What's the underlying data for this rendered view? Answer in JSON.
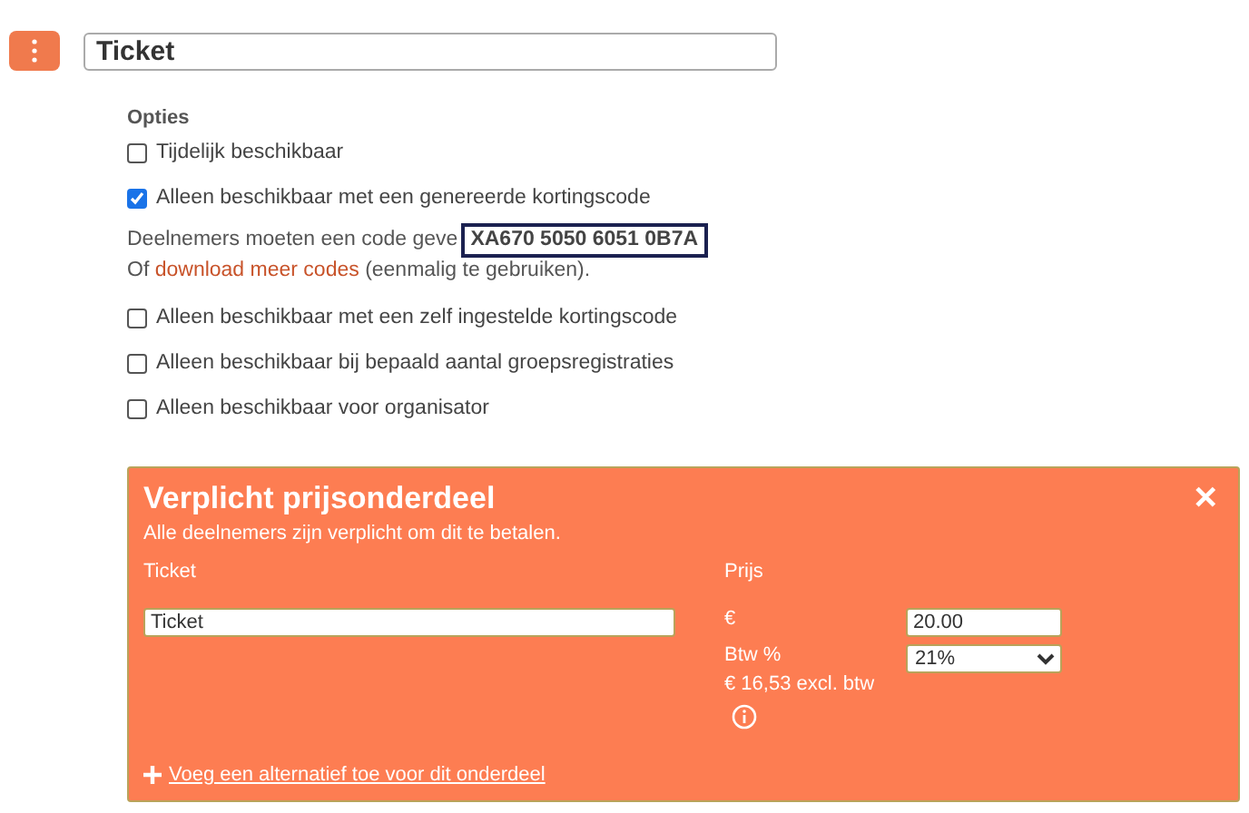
{
  "title_field": {
    "value": "Ticket"
  },
  "options": {
    "heading": "Opties",
    "items": [
      {
        "label": "Tijdelijk beschikbaar",
        "checked": false
      },
      {
        "label": "Alleen beschikbaar met een genereerde kortingscode",
        "checked": true,
        "note": {
          "prefix": "Deelnemers moeten een code geve",
          "code": "XA670 5050 6051 0B7A",
          "line2_start": "Of",
          "link": "download meer codes",
          "line2_end": "(eenmalig te gebruiken)."
        }
      },
      {
        "label": "Alleen beschikbaar met een zelf ingestelde kortingscode",
        "checked": false
      },
      {
        "label": "Alleen beschikbaar bij bepaald aantal groepsregistraties",
        "checked": false
      },
      {
        "label": "Alleen beschikbaar voor organisator",
        "checked": false
      }
    ]
  },
  "price_panel": {
    "title": "Verplicht prijsonderdeel",
    "close": "✕",
    "subtitle": "Alle deelnemers zijn verplicht om dit te betalen.",
    "name_column": {
      "label": "Ticket",
      "value": "Ticket"
    },
    "price_column": {
      "label": "Prijs",
      "currency": "€",
      "amount": "20.00",
      "vat_label": "Btw %",
      "vat_value": "21%",
      "excl_vat": "€ 16,53 excl. btw"
    },
    "add_link": "Voeg een alternatief toe voor dit onderdeel"
  }
}
